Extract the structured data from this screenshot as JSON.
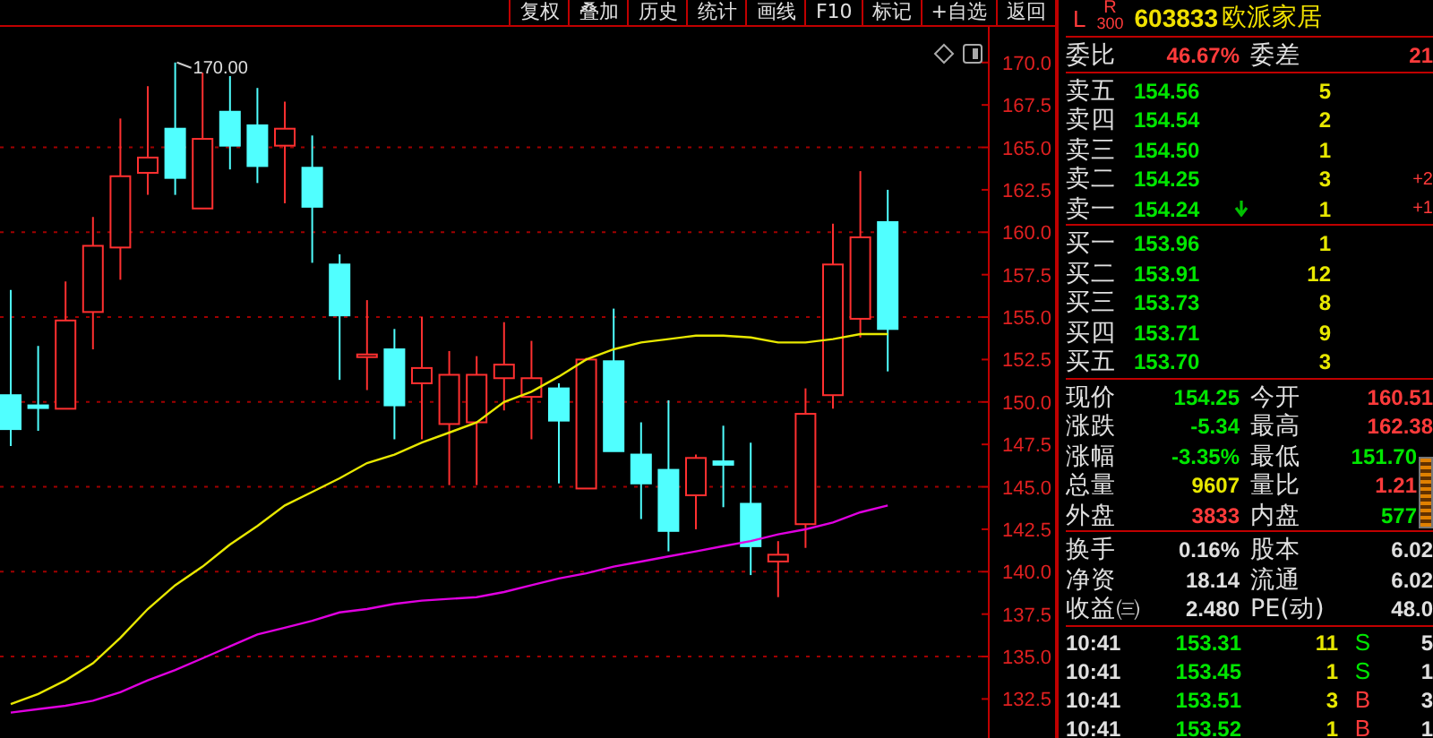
{
  "toolbar": {
    "buttons": [
      "复权",
      "叠加",
      "历史",
      "统计",
      "画线",
      "F10",
      "标记",
      "+自选",
      "返回"
    ]
  },
  "chart": {
    "chart_data": {
      "type": "candlestick",
      "grid": true,
      "ylim": [
        130.2,
        172.1
      ],
      "yticks": [
        {
          "value": 170,
          "label": "170.0"
        },
        {
          "value": 167.5,
          "label": "167.5"
        },
        {
          "value": 165,
          "label": "165.0"
        },
        {
          "value": 162.5,
          "label": "162.5"
        },
        {
          "value": 160,
          "label": "160.0"
        },
        {
          "value": 157.5,
          "label": "157.5"
        },
        {
          "value": 155,
          "label": "155.0"
        },
        {
          "value": 152.5,
          "label": "152.5"
        },
        {
          "value": 150,
          "label": "150.0"
        },
        {
          "value": 147.5,
          "label": "147.5"
        },
        {
          "value": 145,
          "label": "145.0"
        },
        {
          "value": 142.5,
          "label": "142.5"
        },
        {
          "value": 140,
          "label": "140.0"
        },
        {
          "value": 137.5,
          "label": "137.5"
        },
        {
          "value": 135,
          "label": "135.0"
        },
        {
          "value": 132.5,
          "label": "132.5"
        }
      ],
      "series": [
        {
          "type": "line",
          "color": "#e8e800",
          "values": [
            132.2,
            132.8,
            133.6,
            134.6,
            136.1,
            137.8,
            139.2,
            140.3,
            141.6,
            142.7,
            143.9,
            144.7,
            145.5,
            146.4,
            146.9,
            147.6,
            148.2,
            148.8,
            150.0,
            150.6,
            151.5,
            152.5,
            153.1,
            153.5,
            153.7,
            153.9,
            153.9,
            153.8,
            153.5,
            153.5,
            153.7,
            154.0,
            154.0
          ]
        },
        {
          "type": "line",
          "color": "#e000e0",
          "values": [
            131.7,
            131.9,
            132.1,
            132.4,
            132.9,
            133.6,
            134.2,
            134.9,
            135.6,
            136.3,
            136.7,
            137.1,
            137.6,
            137.8,
            138.1,
            138.3,
            138.4,
            138.5,
            138.8,
            139.2,
            139.6,
            139.9,
            140.3,
            140.6,
            140.9,
            141.2,
            141.5,
            141.8,
            142.2,
            142.5,
            142.9,
            143.5,
            143.9
          ]
        }
      ],
      "ohlc": [
        [
          150.4,
          156.6,
          147.4,
          148.4
        ],
        [
          149.8,
          153.3,
          148.3,
          149.7
        ],
        [
          149.6,
          157.1,
          149.6,
          154.8
        ],
        [
          155.3,
          160.9,
          153.1,
          159.2
        ],
        [
          159.1,
          166.7,
          157.2,
          163.3
        ],
        [
          163.5,
          168.6,
          162.2,
          164.4
        ],
        [
          166.1,
          170.0,
          162.2,
          163.2
        ],
        [
          161.4,
          169.4,
          161.4,
          165.5
        ],
        [
          167.1,
          169.2,
          163.7,
          165.1
        ],
        [
          166.3,
          168.5,
          162.9,
          163.9
        ],
        [
          165.1,
          167.7,
          161.7,
          166.1
        ],
        [
          163.8,
          165.7,
          158.2,
          161.5
        ],
        [
          158.1,
          158.7,
          151.3,
          155.1
        ],
        [
          152.7,
          156.0,
          150.7,
          152.8
        ],
        [
          153.1,
          154.3,
          147.8,
          149.8
        ],
        [
          151.1,
          155.0,
          147.8,
          152.0
        ],
        [
          148.7,
          153.0,
          145.1,
          151.6
        ],
        [
          148.8,
          152.7,
          145.1,
          151.6
        ],
        [
          151.4,
          154.7,
          149.5,
          152.2
        ],
        [
          150.3,
          153.6,
          147.8,
          151.4
        ],
        [
          150.8,
          151.1,
          145.2,
          148.9
        ],
        [
          144.9,
          152.6,
          144.9,
          152.5
        ],
        [
          152.4,
          155.5,
          147.1,
          147.1
        ],
        [
          146.9,
          148.8,
          143.1,
          145.2
        ],
        [
          146.0,
          150.1,
          141.2,
          142.4
        ],
        [
          144.5,
          146.9,
          142.5,
          146.7
        ],
        [
          146.5,
          148.6,
          143.8,
          146.3
        ],
        [
          144.0,
          147.6,
          139.8,
          141.5
        ],
        [
          140.6,
          141.8,
          138.5,
          141.0
        ],
        [
          142.8,
          150.8,
          141.4,
          149.3
        ],
        [
          150.4,
          160.5,
          149.6,
          158.1
        ],
        [
          154.9,
          163.6,
          153.8,
          159.7
        ],
        [
          160.6,
          162.5,
          151.8,
          154.3
        ]
      ],
      "annotations": [
        "170.00"
      ]
    }
  },
  "quote": {
    "market": "L",
    "board": "R",
    "board_number": "300",
    "code": "603833",
    "name": "欧派家居"
  },
  "commission": {
    "label": "委比",
    "ratio": "46.67%",
    "diff_label": "委差",
    "diff": "21"
  },
  "asks": [
    {
      "label": "卖五",
      "price": "154.56",
      "volume": "5",
      "tick_down": false
    },
    {
      "label": "卖四",
      "price": "154.54",
      "volume": "2",
      "tick_down": false
    },
    {
      "label": "卖三",
      "price": "154.50",
      "volume": "1",
      "tick_down": false
    },
    {
      "label": "卖二",
      "price": "154.25",
      "volume": "3",
      "change": "+2",
      "tick_down": false
    },
    {
      "label": "卖一",
      "price": "154.24",
      "volume": "1",
      "change": "+1",
      "tick_down": true
    }
  ],
  "bids": [
    {
      "label": "买一",
      "price": "153.96",
      "volume": "1",
      "tick_down": false
    },
    {
      "label": "买二",
      "price": "153.91",
      "volume": "12",
      "tick_down": false
    },
    {
      "label": "买三",
      "price": "153.73",
      "volume": "8",
      "tick_down": false
    },
    {
      "label": "买四",
      "price": "153.71",
      "volume": "9",
      "tick_down": false
    },
    {
      "label": "买五",
      "price": "153.70",
      "volume": "3",
      "tick_down": false
    }
  ],
  "stats": [
    {
      "cells": [
        {
          "label": "现价",
          "value": "154.25",
          "color": "#00e600"
        },
        {
          "label": "今开",
          "value": "160.51",
          "color": "#ff3b3b"
        }
      ]
    },
    {
      "cells": [
        {
          "label": "涨跌",
          "value": "-5.34",
          "color": "#00e600"
        },
        {
          "label": "最高",
          "value": "162.38",
          "color": "#ff3b3b"
        }
      ]
    },
    {
      "cells": [
        {
          "label": "涨幅",
          "value": "-3.35%",
          "color": "#00e600"
        },
        {
          "label": "最低",
          "value": "151.70",
          "color": "#00e600"
        }
      ]
    },
    {
      "cells": [
        {
          "label": "总量",
          "value": "9607",
          "color": "#e8e800"
        },
        {
          "label": "量比",
          "value": "1.21",
          "color": "#ff3b3b"
        }
      ]
    },
    {
      "cells": [
        {
          "label": "外盘",
          "value": "3833",
          "color": "#ff3b3b"
        },
        {
          "label": "内盘",
          "value": "577",
          "color": "#00e600"
        }
      ]
    }
  ],
  "fundamentals": [
    {
      "cells": [
        {
          "label": "换手",
          "value": "0.16%"
        },
        {
          "label": "股本",
          "value": "6.02"
        }
      ]
    },
    {
      "cells": [
        {
          "label": "净资",
          "value": "18.14"
        },
        {
          "label": "流通",
          "value": "6.02"
        }
      ]
    },
    {
      "cells": [
        {
          "label": "收益㈢",
          "value": "2.480"
        },
        {
          "label": "PE(动)",
          "value": "48.0"
        }
      ]
    }
  ],
  "trades": [
    {
      "time": "10:41",
      "price": "153.31",
      "volume": "11",
      "side": "S",
      "color": "#00e600",
      "count": "5"
    },
    {
      "time": "10:41",
      "price": "153.45",
      "volume": "1",
      "side": "S",
      "color": "#00e600",
      "count": "1"
    },
    {
      "time": "10:41",
      "price": "153.51",
      "volume": "3",
      "side": "B",
      "color": "#ff3b3b",
      "count": "3"
    },
    {
      "time": "10:41",
      "price": "153.52",
      "volume": "1",
      "side": "B",
      "color": "#ff3b3b",
      "count": "1"
    }
  ]
}
